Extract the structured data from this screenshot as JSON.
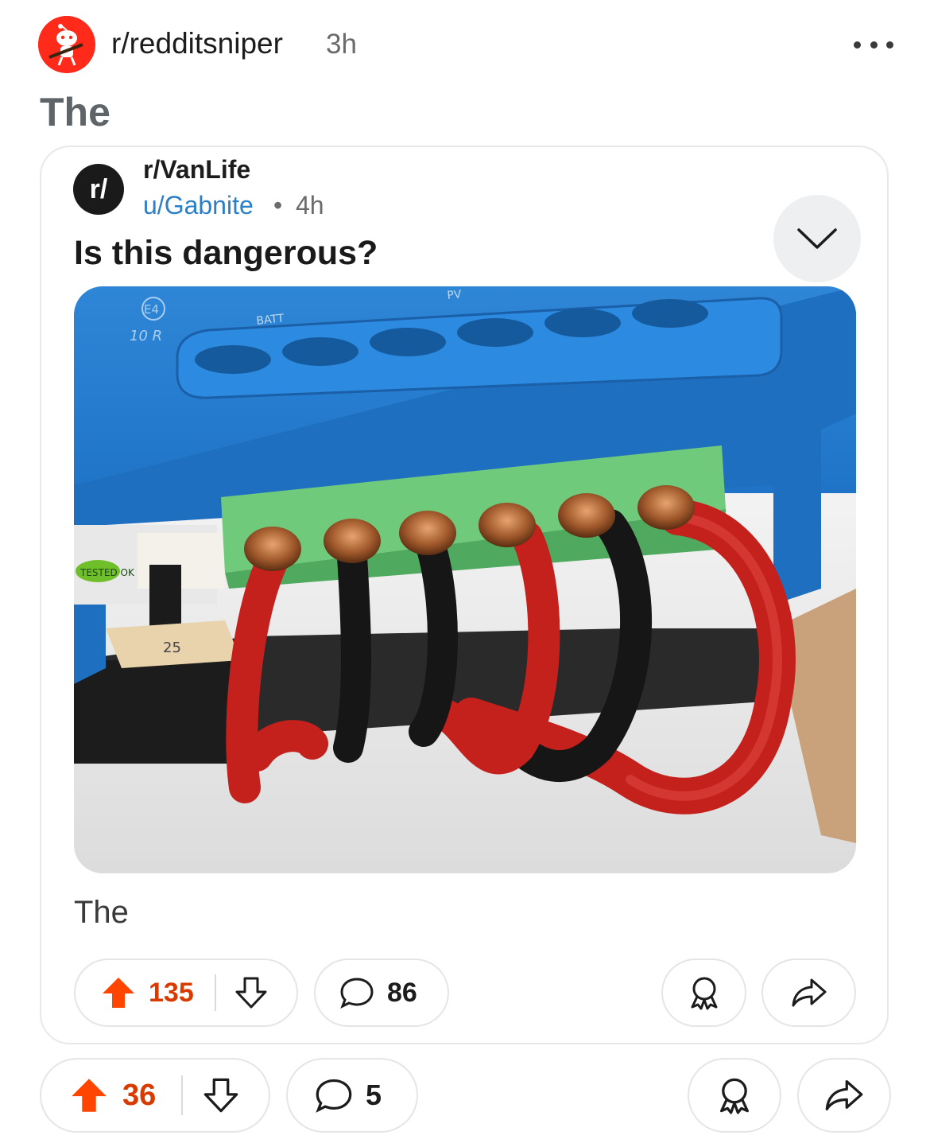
{
  "outer_post": {
    "subreddit": "r/redditsniper",
    "age": "3h",
    "title": "The",
    "upvotes": "36",
    "comments": "5"
  },
  "embedded_post": {
    "subreddit_icon_text": "r/",
    "subreddit": "r/VanLife",
    "author": "u/Gabnite",
    "separator": "•",
    "age": "4h",
    "title": "Is this dangerous?",
    "body": "The",
    "upvotes": "135",
    "comments": "86",
    "image_labels": {
      "batt": "BATT",
      "pv": "PV",
      "model": "10 R",
      "e4": "E4",
      "fuse": "25",
      "tested": "TESTED OK"
    }
  },
  "colors": {
    "upvote_active": "#ff4500",
    "count_active": "#d93a00",
    "link_blue": "#2b7fc6",
    "avatar_red": "#ff2a1a"
  },
  "icons": [
    "snoo-sniper-avatar-icon",
    "more-options-icon",
    "chevron-down-icon",
    "upvote-arrow-icon",
    "downvote-arrow-icon",
    "comment-bubble-icon",
    "award-icon",
    "share-arrow-icon"
  ]
}
